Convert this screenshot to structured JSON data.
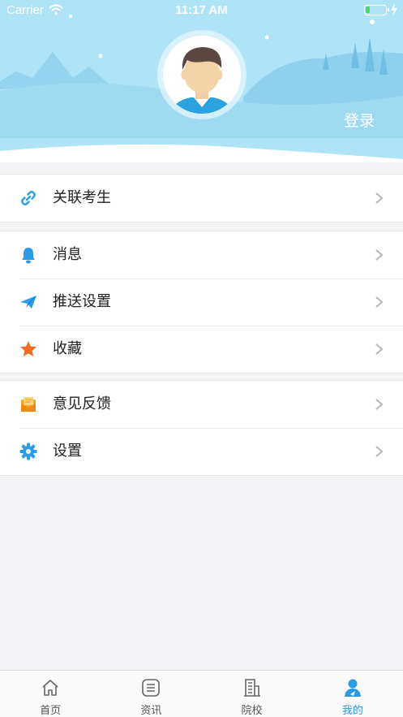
{
  "status_bar": {
    "carrier": "Carrier",
    "time": "11:17 AM",
    "battery_level": 0.2
  },
  "header": {
    "login_label": "登录"
  },
  "menu_groups": [
    {
      "items": [
        {
          "label": "关联考生",
          "icon": "link-icon"
        }
      ]
    },
    {
      "items": [
        {
          "label": "消息",
          "icon": "bell-icon"
        },
        {
          "label": "推送设置",
          "icon": "paper-plane-icon"
        },
        {
          "label": "收藏",
          "icon": "star-icon"
        }
      ]
    },
    {
      "items": [
        {
          "label": "意见反馈",
          "icon": "mail-icon"
        },
        {
          "label": "设置",
          "icon": "gear-icon"
        }
      ]
    }
  ],
  "tabbar": {
    "tabs": [
      {
        "label": "首页",
        "icon": "home-icon",
        "active": false
      },
      {
        "label": "资讯",
        "icon": "news-icon",
        "active": false
      },
      {
        "label": "院校",
        "icon": "building-icon",
        "active": false
      },
      {
        "label": "我的",
        "icon": "user-icon",
        "active": true
      }
    ]
  },
  "colors": {
    "accent": "#2b9be6",
    "header_sky": "#aee3f8",
    "star": "#f36b21",
    "mail": "#f5a623"
  }
}
